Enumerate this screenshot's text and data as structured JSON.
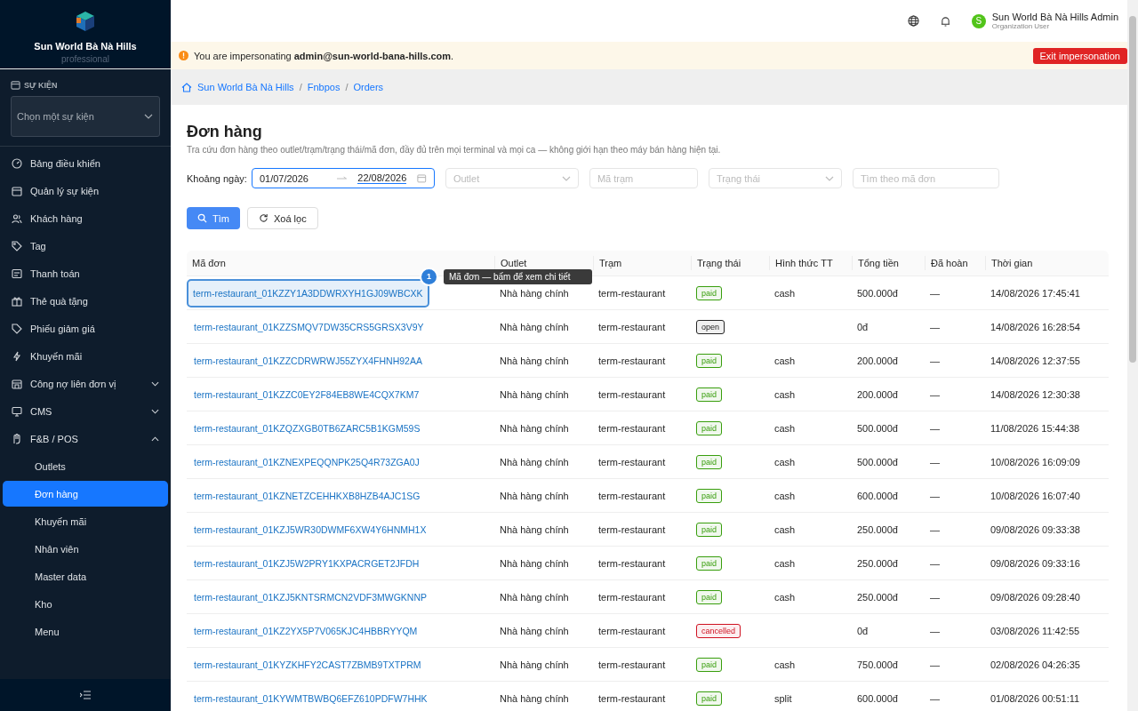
{
  "sidebar": {
    "brand": "Sun World Bà Nà Hills",
    "plan": "professional",
    "event_section": {
      "label": "SỰ KIỆN",
      "select_placeholder": "Chọn một sự kiện"
    },
    "items": [
      {
        "label": "Bảng điều khiển",
        "selected": false
      },
      {
        "label": "Quản lý sự kiện",
        "selected": false
      },
      {
        "label": "Khách hàng",
        "selected": false
      },
      {
        "label": "Tag",
        "selected": false
      },
      {
        "label": "Thanh toán",
        "selected": false
      },
      {
        "label": "Thẻ quà tặng",
        "selected": false
      },
      {
        "label": "Phiếu giảm giá",
        "selected": false
      },
      {
        "label": "Khuyến mãi",
        "selected": false
      },
      {
        "label": "Công nợ liên đơn vị",
        "selected": false,
        "expanded": false
      },
      {
        "label": "CMS",
        "selected": false,
        "expanded": false
      },
      {
        "label": "F&B / POS",
        "selected": false,
        "expanded": true,
        "children": [
          {
            "label": "Outlets",
            "selected": false
          },
          {
            "label": "Đơn hàng",
            "selected": true
          },
          {
            "label": "Khuyến mãi",
            "selected": false
          },
          {
            "label": "Nhân viên",
            "selected": false
          },
          {
            "label": "Master data",
            "selected": false
          },
          {
            "label": "Kho",
            "selected": false
          },
          {
            "label": "Menu",
            "selected": false
          }
        ]
      }
    ]
  },
  "header": {
    "user_name": "Sun World Bà Nà Hills Admin",
    "user_role": "Organization User",
    "avatar_letter": "S"
  },
  "impersonation_banner": {
    "prefix": "You are impersonating ",
    "email": "admin@sun-world-bana-hills.com",
    "suffix": ".",
    "button": "Exit impersonation"
  },
  "breadcrumb": {
    "items": [
      "Sun World Bà Nà Hills",
      "Fnbpos",
      "Orders"
    ],
    "separator": "/"
  },
  "page": {
    "title": "Đơn hàng",
    "description": "Tra cứu đơn hàng theo outlet/trạm/trạng thái/mã đơn, đầy đủ trên mọi terminal và mọi ca — không giới hạn theo máy bán hàng hiện tại."
  },
  "filters": {
    "date_label": "Khoảng ngày:",
    "date_from": "01/07/2026",
    "date_to": "22/08/2026",
    "outlet_placeholder": "Outlet",
    "station_placeholder": "Mã trạm",
    "status_placeholder": "Trạng thái",
    "search_placeholder": "Tìm theo mã đơn",
    "search_button": "Tìm",
    "clear_button": "Xoá lọc"
  },
  "table": {
    "columns": [
      "Mã đơn",
      "Outlet",
      "Trạm",
      "Trạng thái",
      "Hình thức TT",
      "Tổng tiền",
      "Đã hoàn",
      "Thời gian"
    ],
    "rows": [
      {
        "order_id": "term-restaurant_01KZZY1A3DDWRXYH1GJ09WBCXK",
        "outlet": "Nhà hàng chính",
        "station": "term-restaurant",
        "status": "paid",
        "color": "#389e0d",
        "payment": "cash",
        "total": "500.000đ",
        "refunded": "—",
        "time": "14/08/2026 17:45:41",
        "focused": true
      },
      {
        "order_id": "term-restaurant_01KZZSMQV7DW35CRS5GRSX3V9Y",
        "outlet": "Nhà hàng chính",
        "station": "term-restaurant",
        "status": "open",
        "color": "#262626",
        "payment": "",
        "total": "0đ",
        "refunded": "—",
        "time": "14/08/2026 16:28:54",
        "focused": false
      },
      {
        "order_id": "term-restaurant_01KZZCDRWRWJ55ZYX4FHNH92AA",
        "outlet": "Nhà hàng chính",
        "station": "term-restaurant",
        "status": "paid",
        "color": "#389e0d",
        "payment": "cash",
        "total": "200.000đ",
        "refunded": "—",
        "time": "14/08/2026 12:37:55",
        "focused": false
      },
      {
        "order_id": "term-restaurant_01KZZC0EY2F84EB8WE4CQX7KM7",
        "outlet": "Nhà hàng chính",
        "station": "term-restaurant",
        "status": "paid",
        "color": "#389e0d",
        "payment": "cash",
        "total": "200.000đ",
        "refunded": "—",
        "time": "14/08/2026 12:30:38",
        "focused": false
      },
      {
        "order_id": "term-restaurant_01KZQZXGB0TB6ZARC5B1KGM59S",
        "outlet": "Nhà hàng chính",
        "station": "term-restaurant",
        "status": "paid",
        "color": "#389e0d",
        "payment": "cash",
        "total": "500.000đ",
        "refunded": "—",
        "time": "11/08/2026 15:44:38",
        "focused": false
      },
      {
        "order_id": "term-restaurant_01KZNEXPEQQNPK25Q4R73ZGA0J",
        "outlet": "Nhà hàng chính",
        "station": "term-restaurant",
        "status": "paid",
        "color": "#389e0d",
        "payment": "cash",
        "total": "500.000đ",
        "refunded": "—",
        "time": "10/08/2026 16:09:09",
        "focused": false
      },
      {
        "order_id": "term-restaurant_01KZNETZCEHHKXB8HZB4AJC1SG",
        "outlet": "Nhà hàng chính",
        "station": "term-restaurant",
        "status": "paid",
        "color": "#389e0d",
        "payment": "cash",
        "total": "600.000đ",
        "refunded": "—",
        "time": "10/08/2026 16:07:40",
        "focused": false
      },
      {
        "order_id": "term-restaurant_01KZJ5WR30DWMF6XW4Y6HNMH1X",
        "outlet": "Nhà hàng chính",
        "station": "term-restaurant",
        "status": "paid",
        "color": "#389e0d",
        "payment": "cash",
        "total": "250.000đ",
        "refunded": "—",
        "time": "09/08/2026 09:33:38",
        "focused": false
      },
      {
        "order_id": "term-restaurant_01KZJ5W2PRY1KXPACRGET2JFDH",
        "outlet": "Nhà hàng chính",
        "station": "term-restaurant",
        "status": "paid",
        "color": "#389e0d",
        "payment": "cash",
        "total": "250.000đ",
        "refunded": "—",
        "time": "09/08/2026 09:33:16",
        "focused": false
      },
      {
        "order_id": "term-restaurant_01KZJ5KNTSRMCN2VDF3MWGKNNP",
        "outlet": "Nhà hàng chính",
        "station": "term-restaurant",
        "status": "paid",
        "color": "#389e0d",
        "payment": "cash",
        "total": "250.000đ",
        "refunded": "—",
        "time": "09/08/2026 09:28:40",
        "focused": false
      },
      {
        "order_id": "term-restaurant_01KZ2YX5P7V065KJC4HBBRYYQM",
        "outlet": "Nhà hàng chính",
        "station": "term-restaurant",
        "status": "cancelled",
        "color": "#cf1322",
        "payment": "",
        "total": "0đ",
        "refunded": "—",
        "time": "03/08/2026 11:42:55",
        "focused": false
      },
      {
        "order_id": "term-restaurant_01KYZKHFY2CAST7ZBMB9TXTPRM",
        "outlet": "Nhà hàng chính",
        "station": "term-restaurant",
        "status": "paid",
        "color": "#389e0d",
        "payment": "cash",
        "total": "750.000đ",
        "refunded": "—",
        "time": "02/08/2026 04:26:35",
        "focused": false
      },
      {
        "order_id": "term-restaurant_01KYWMTBWBQ6EFZ610PDFW7HHK",
        "outlet": "Nhà hàng chính",
        "station": "term-restaurant",
        "status": "paid",
        "color": "#389e0d",
        "payment": "split",
        "total": "600.000đ",
        "refunded": "—",
        "time": "01/08/2026 00:51:11",
        "focused": false
      }
    ]
  },
  "tour_hint": {
    "step": "1",
    "text": "Mã đơn — bấm để xem chi tiết"
  }
}
